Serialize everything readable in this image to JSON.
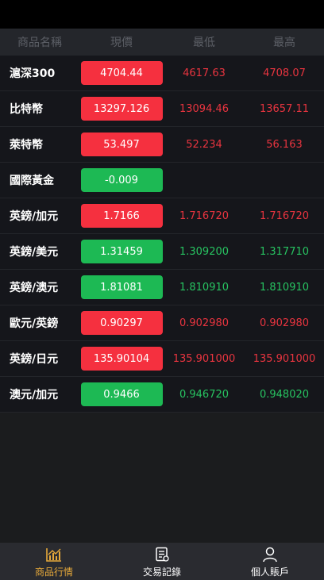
{
  "header": {
    "name_col": "商品名稱",
    "price_col": "現價",
    "low_col": "最低",
    "high_col": "最高"
  },
  "rows": [
    {
      "name": "滬深300",
      "price": "4704.44",
      "low": "4617.63",
      "high": "4708.07",
      "direction": "up"
    },
    {
      "name": "比特幣",
      "price": "13297.126",
      "low": "13094.46",
      "high": "13657.11",
      "direction": "up"
    },
    {
      "name": "萊特幣",
      "price": "53.497",
      "low": "52.234",
      "high": "56.163",
      "direction": "up"
    },
    {
      "name": "國際黃金",
      "price": "-0.009",
      "low": "",
      "high": "",
      "direction": "down"
    },
    {
      "name": "英鎊/加元",
      "price": "1.7166",
      "low": "1.716720",
      "high": "1.716720",
      "direction": "up"
    },
    {
      "name": "英鎊/美元",
      "price": "1.31459",
      "low": "1.309200",
      "high": "1.317710",
      "direction": "down"
    },
    {
      "name": "英鎊/澳元",
      "price": "1.81081",
      "low": "1.810910",
      "high": "1.810910",
      "direction": "down"
    },
    {
      "name": "歐元/英鎊",
      "price": "0.90297",
      "low": "0.902980",
      "high": "0.902980",
      "direction": "up"
    },
    {
      "name": "英鎊/日元",
      "price": "135.90104",
      "low": "135.901000",
      "high": "135.901000",
      "direction": "up"
    },
    {
      "name": "澳元/加元",
      "price": "0.9466",
      "low": "0.946720",
      "high": "0.948020",
      "direction": "down"
    }
  ],
  "tabs": [
    {
      "label": "商品行情",
      "icon": "chart-icon",
      "active": true
    },
    {
      "label": "交易記錄",
      "icon": "document-icon",
      "active": false
    },
    {
      "label": "個人賬戶",
      "icon": "user-icon",
      "active": false
    }
  ],
  "colors": {
    "up": "#f5303f",
    "down": "#1db954",
    "active_tab": "#e7a93a"
  }
}
